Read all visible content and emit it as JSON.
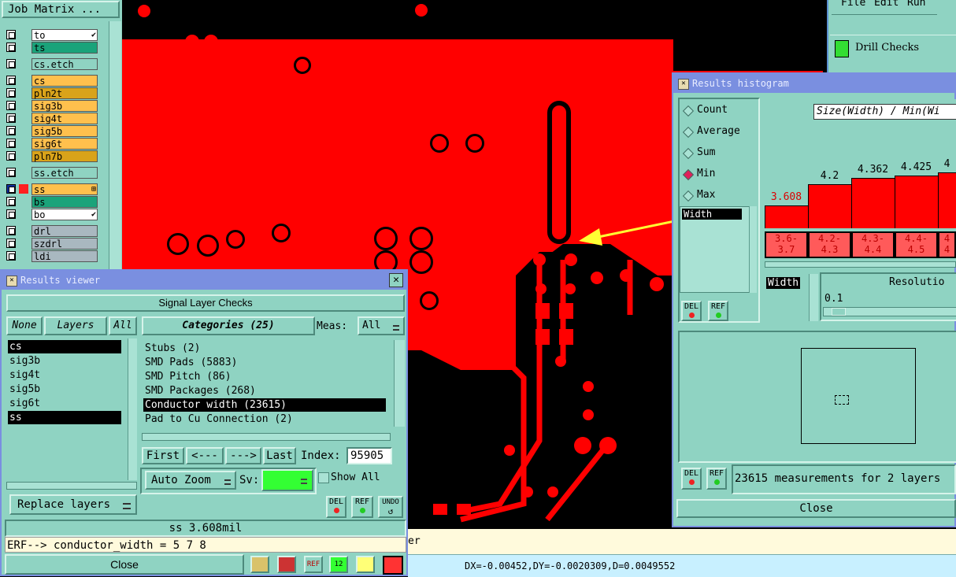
{
  "job_matrix": {
    "title": "Job Matrix ...",
    "layers": [
      {
        "name": "to",
        "color": "#ffffff",
        "mark": "✔"
      },
      {
        "name": "ts",
        "color": "#1aa37a",
        "mark": ""
      },
      {
        "name": "cs.etch",
        "color": "#8fd3c2",
        "mark": ""
      },
      {
        "name": "cs",
        "color": "#ffc04d",
        "mark": ""
      },
      {
        "name": "pln2t",
        "color": "#d9a31a",
        "mark": ""
      },
      {
        "name": "sig3b",
        "color": "#ffc04d",
        "mark": ""
      },
      {
        "name": "sig4t",
        "color": "#ffc04d",
        "mark": ""
      },
      {
        "name": "sig5b",
        "color": "#ffc04d",
        "mark": ""
      },
      {
        "name": "sig6t",
        "color": "#ffc04d",
        "mark": ""
      },
      {
        "name": "pln7b",
        "color": "#d9a31a",
        "mark": ""
      },
      {
        "name": "ss.etch",
        "color": "#8fd3c2",
        "mark": ""
      },
      {
        "name": "ss",
        "color": "#ffc04d",
        "mark": "⊞"
      },
      {
        "name": "bs",
        "color": "#1aa37a",
        "mark": ""
      },
      {
        "name": "bo",
        "color": "#ffffff",
        "mark": "✔"
      },
      {
        "name": "drl",
        "color": "#a9b8c0",
        "mark": ""
      },
      {
        "name": "szdrl",
        "color": "#a9b8c0",
        "mark": ""
      },
      {
        "name": "ldi",
        "color": "#a9b8c0",
        "mark": ""
      }
    ]
  },
  "top_menu": {
    "file": "File",
    "edit": "Edit",
    "run": "Run"
  },
  "drill_checks": {
    "label": "Drill Checks"
  },
  "results_viewer": {
    "title": "Results viewer",
    "header": "Signal Layer Checks",
    "none_label": "None",
    "layers_label": "Layers",
    "all_label": "All",
    "layers": [
      "cs",
      "sig3b",
      "sig4t",
      "sig5b",
      "sig6t",
      "ss"
    ],
    "categories_label": "Categories (25)",
    "meas_label": "Meas:",
    "meas_value": "All",
    "categories": [
      "Stubs (2)",
      "SMD Pads (5883)",
      "SMD Pitch (86)",
      "SMD Packages (268)",
      "Conductor width (23615)",
      "Pad to Cu Connection (2)"
    ],
    "nav": {
      "first": "First",
      "prev": "<---",
      "next": "--->",
      "last": "Last",
      "index_label": "Index:",
      "index_value": "95905"
    },
    "auto_zoom": "Auto Zoom",
    "sv_label": "Sv:",
    "show_all": "Show All",
    "replace_layers": "Replace layers",
    "del": "DEL",
    "ref": "REF",
    "undo": "UNDO",
    "status": "ss 3.608mil",
    "command": "ERF--> conductor_width = 5 7 8",
    "close": "Close"
  },
  "results_histogram": {
    "title": "Results histogram",
    "modes": [
      "Count",
      "Average",
      "Sum",
      "Min",
      "Max"
    ],
    "selected_mode": "Min",
    "list_item": "Width",
    "chart_title": "Size(Width) / Min(Wi",
    "del": "DEL",
    "ref": "REF",
    "width_label": "Width",
    "resolution_label": "Resolutio",
    "resolution_value": "0.1",
    "summary": "23615 measurements for 2 layers",
    "close": "Close"
  },
  "chart_data": {
    "type": "bar",
    "title": "Size(Width) / Min(Wi",
    "categories": [
      "3.6-3.7",
      "4.2-4.3",
      "4.3-4.4",
      "4.4-4.5",
      "4"
    ],
    "values": [
      3.608,
      4.2,
      4.362,
      4.425,
      4.5
    ],
    "value_labels": [
      "3.608",
      "4.2",
      "4.362",
      "4.425",
      "4"
    ],
    "bin_labels_top": [
      "3.6-",
      "4.2-",
      "4.3-",
      "4.4-",
      "4"
    ],
    "bin_labels_bottom": [
      "3.7",
      "4.3",
      "4.4",
      "4.5",
      "4"
    ],
    "highlight_color": "#ff0000",
    "xlabel": "",
    "ylabel": ""
  },
  "status_bar": {
    "partial_text": "er",
    "coords": "DX=-0.00452,DY=-0.0020309,D=0.0049552"
  }
}
